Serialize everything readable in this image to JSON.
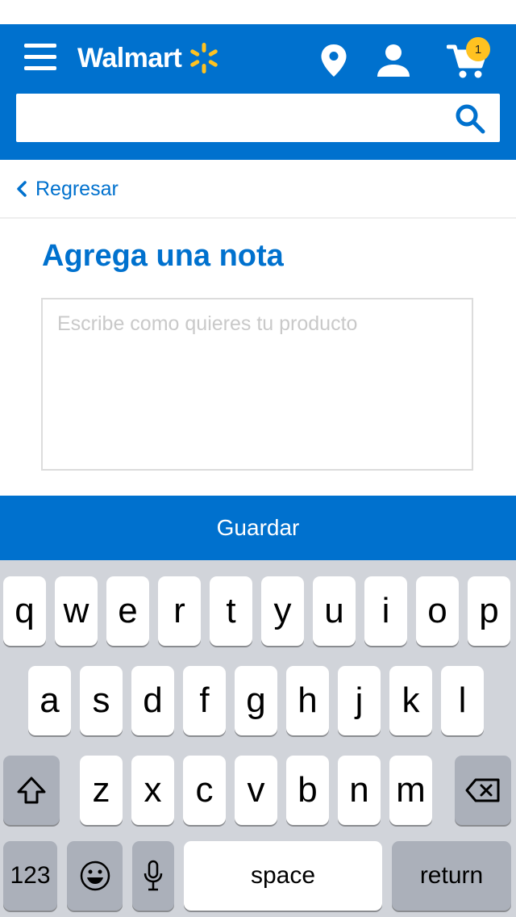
{
  "header": {
    "logo_text": "Walmart",
    "cart_count": "1",
    "search_placeholder": ""
  },
  "nav": {
    "back_label": "Regresar"
  },
  "main": {
    "title": "Agrega una nota",
    "note_placeholder": "Escribe como quieres tu producto",
    "note_value": "",
    "save_label": "Guardar"
  },
  "keyboard": {
    "row1": [
      "q",
      "w",
      "e",
      "r",
      "t",
      "y",
      "u",
      "i",
      "o",
      "p"
    ],
    "row2": [
      "a",
      "s",
      "d",
      "f",
      "g",
      "h",
      "j",
      "k",
      "l"
    ],
    "row3": [
      "z",
      "x",
      "c",
      "v",
      "b",
      "n",
      "m"
    ],
    "numbers_label": "123",
    "space_label": "space",
    "return_label": "return"
  },
  "colors": {
    "brand_blue": "#0071ce",
    "spark_yellow": "#ffc220",
    "keyboard_bg": "#d1d4da"
  }
}
